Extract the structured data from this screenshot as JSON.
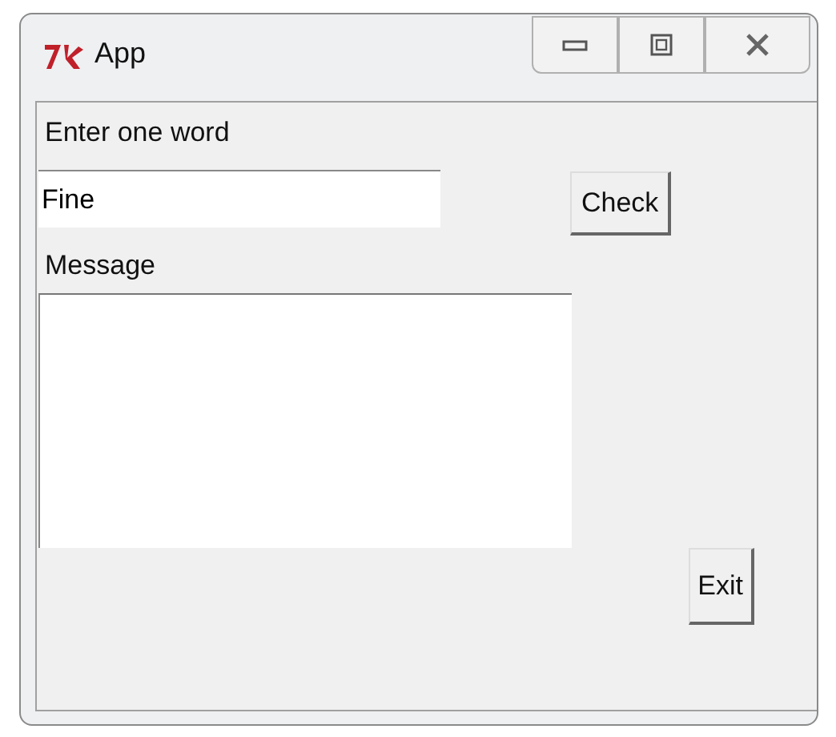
{
  "window": {
    "title": "App"
  },
  "word_label": "Enter one word",
  "word_field": {
    "value": "Fine"
  },
  "check_button": "Check",
  "message_label": "Message",
  "exit_button": "Exit"
}
